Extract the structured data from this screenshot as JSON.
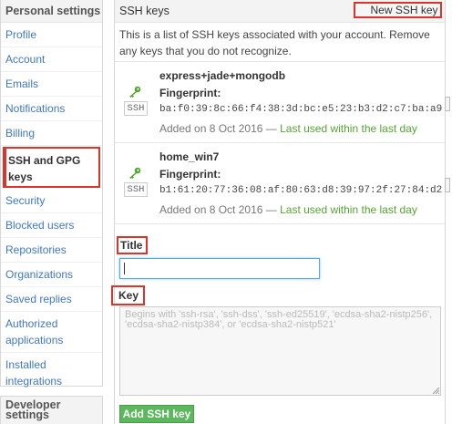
{
  "sidebar": {
    "header": "Personal settings",
    "items": [
      {
        "label": "Profile"
      },
      {
        "label": "Account"
      },
      {
        "label": "Emails"
      },
      {
        "label": "Notifications"
      },
      {
        "label": "Billing"
      },
      {
        "label": "SSH and GPG keys",
        "active": true
      },
      {
        "label": "Security"
      },
      {
        "label": "Blocked users"
      },
      {
        "label": "Repositories"
      },
      {
        "label": "Organizations"
      },
      {
        "label": "Saved replies"
      },
      {
        "label": "Authorized applications"
      },
      {
        "label": "Installed integrations"
      }
    ],
    "developer_header": "Developer settings"
  },
  "panel": {
    "title": "SSH keys",
    "new_key_button": "New SSH key",
    "intro": "This is a list of SSH keys associated with your account. Remove any keys that you do not recognize."
  },
  "keys": [
    {
      "title": "express+jade+mongodb",
      "badge": "SSH",
      "fingerprint_label": "Fingerprint:",
      "fingerprint": "ba:f0:39:8c:66:f4:38:3d:bc:e5:23:b3:d2:c7:ba:a9",
      "added": "Added on 8 Oct 2016 — ",
      "last_used": "Last used within the last day"
    },
    {
      "title": "home_win7",
      "badge": "SSH",
      "fingerprint_label": "Fingerprint:",
      "fingerprint": "b1:61:20:77:36:08:af:80:63:d8:39:97:2f:27:84:d2",
      "added": "Added on 8 Oct 2016 — ",
      "last_used": "Last used within the last day"
    }
  ],
  "form": {
    "title_label": "Title",
    "title_value": "",
    "key_label": "Key",
    "key_placeholder": "Begins with 'ssh-rsa', 'ssh-dss', 'ssh-ed25519', 'ecdsa-sha2-nistp256', 'ecdsa-sha2-nistp384', or 'ecdsa-sha2-nistp521'",
    "submit_label": "Add SSH key"
  },
  "colors": {
    "link": "#4078c0",
    "highlight_border": "#d9352b",
    "last_used": "#55a532",
    "add_button": "#5cb85c",
    "key_icon": "#55a532"
  },
  "icons": {
    "key": "key-icon"
  }
}
